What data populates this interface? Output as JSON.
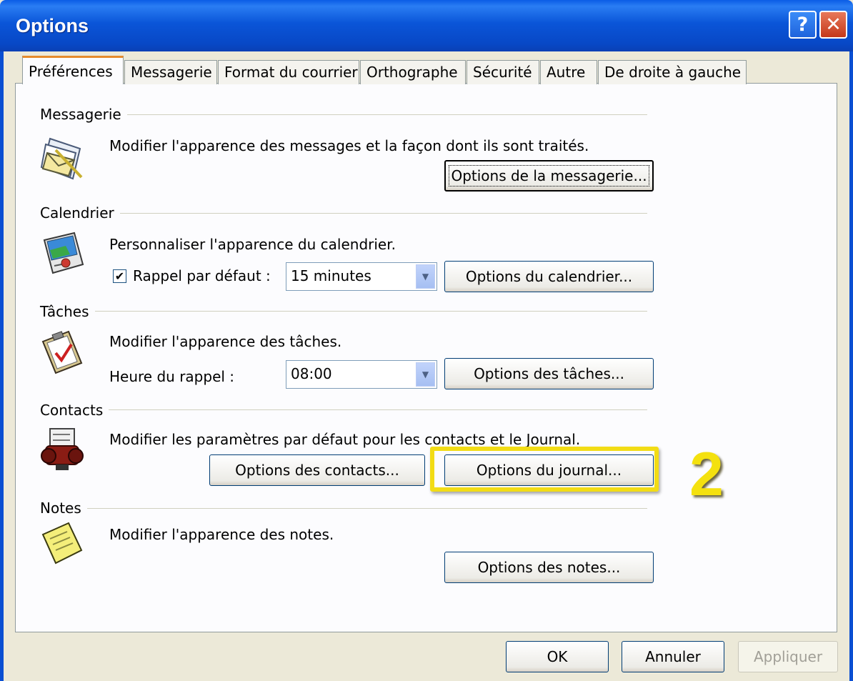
{
  "window": {
    "title": "Options",
    "help_glyph": "?",
    "close_glyph": "✕"
  },
  "tabs": [
    {
      "label": "Préférences",
      "active": true
    },
    {
      "label": "Messagerie",
      "active": false
    },
    {
      "label": "Format du courrier",
      "active": false
    },
    {
      "label": "Orthographe",
      "active": false
    },
    {
      "label": "Sécurité",
      "active": false
    },
    {
      "label": "Autre",
      "active": false
    },
    {
      "label": "De droite à gauche",
      "active": false
    }
  ],
  "sections": {
    "messagerie": {
      "header": "Messagerie",
      "description": "Modifier l'apparence des messages et la façon dont ils sont traités.",
      "button": "Options de la messagerie...",
      "icon": "envelope-icon"
    },
    "calendrier": {
      "header": "Calendrier",
      "description": "Personnaliser l'apparence du calendrier.",
      "reminder_label": "Rappel par défaut :",
      "reminder_checked": true,
      "reminder_value": "15 minutes",
      "button": "Options du calendrier...",
      "icon": "calendar-icon"
    },
    "taches": {
      "header": "Tâches",
      "description": "Modifier l'apparence des tâches.",
      "time_label": "Heure du rappel :",
      "time_value": "08:00",
      "button": "Options des tâches...",
      "icon": "clipboard-icon"
    },
    "contacts": {
      "header": "Contacts",
      "description": "Modifier les paramètres par défaut pour les contacts et le Journal.",
      "contacts_button": "Options des contacts...",
      "journal_button": "Options du journal...",
      "icon": "rolodex-icon"
    },
    "notes": {
      "header": "Notes",
      "description": "Modifier l'apparence des notes.",
      "button": "Options des notes...",
      "icon": "note-icon"
    }
  },
  "footer": {
    "ok": "OK",
    "cancel": "Annuler",
    "apply": "Appliquer"
  },
  "annotation": {
    "number": "2",
    "color": "#f2dc15"
  }
}
